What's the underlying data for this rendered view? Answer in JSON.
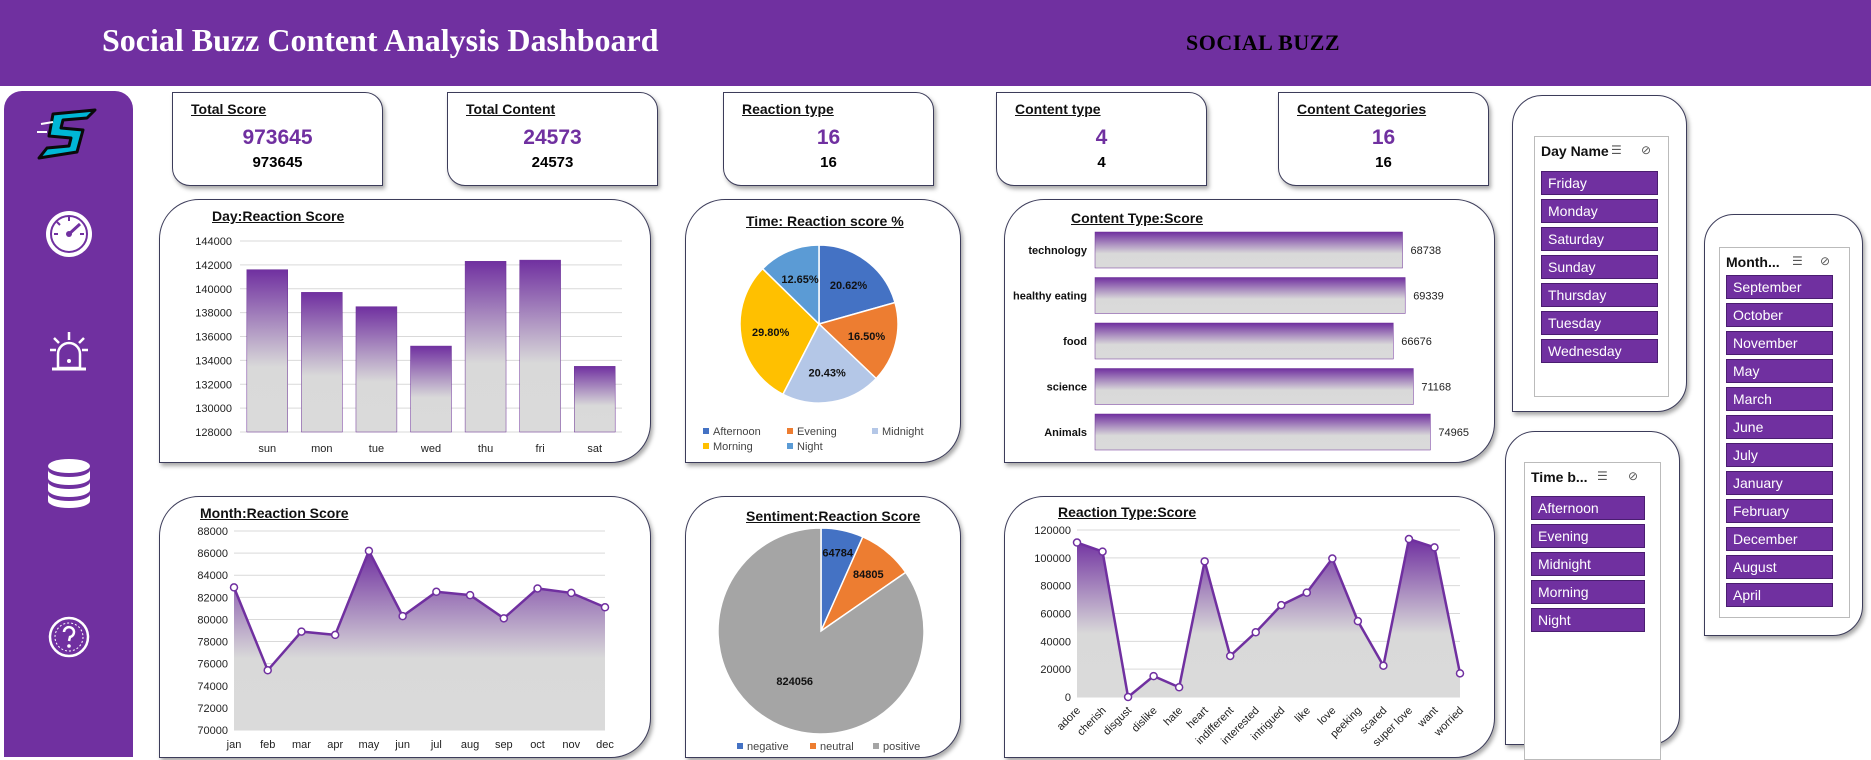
{
  "header": {
    "title": "Social Buzz Content Analysis Dashboard",
    "brand": "SOCIAL BUZZ"
  },
  "sidebar": {
    "icons": [
      "logo-icon",
      "speedometer-icon",
      "alarm-icon",
      "database-icon",
      "help-icon"
    ]
  },
  "kpis": [
    {
      "label": "Total Score",
      "big": "973645",
      "small": "973645"
    },
    {
      "label": "Total Content",
      "big": "24573",
      "small": "24573"
    },
    {
      "label": "Reaction type",
      "big": "16",
      "small": "16"
    },
    {
      "label": "Content type",
      "big": "4",
      "small": "4"
    },
    {
      "label": "Content Categories",
      "big": "16",
      "small": "16"
    }
  ],
  "charts": {
    "day": {
      "title": "Day:Reaction Score"
    },
    "time": {
      "title": "Time: Reaction score %"
    },
    "content": {
      "title": "Content Type:Score"
    },
    "month": {
      "title": "Month:Reaction Score"
    },
    "sentiment": {
      "title": "Sentiment:Reaction Score"
    },
    "reaction": {
      "title": "Reaction Type:Score"
    }
  },
  "chart_data": [
    {
      "id": "day",
      "type": "bar",
      "title": "Day:Reaction Score",
      "categories": [
        "sun",
        "mon",
        "tue",
        "wed",
        "thu",
        "fri",
        "sat"
      ],
      "values": [
        141600,
        139700,
        138500,
        135200,
        142300,
        142400,
        133500
      ],
      "ylim": [
        128000,
        144000
      ],
      "yticks": [
        "144000",
        "142000",
        "140000",
        "138000",
        "136000",
        "134000",
        "132000",
        "130000",
        "128000"
      ]
    },
    {
      "id": "time",
      "type": "pie",
      "title": "Time: Reaction score %",
      "labels": [
        "Afternoon",
        "Evening",
        "Midnight",
        "Morning",
        "Night"
      ],
      "values": [
        20.62,
        16.5,
        20.43,
        29.8,
        12.65
      ],
      "data_labels": [
        "20.62%",
        "16.50%",
        "20.43%",
        "29.80%",
        "12.65%"
      ],
      "colors": [
        "#4472C4",
        "#ED7D31",
        "#B4C7E7",
        "#FFC000",
        "#5B9BD5"
      ]
    },
    {
      "id": "content",
      "type": "bar",
      "orientation": "horizontal",
      "title": "Content Type:Score",
      "categories": [
        "technology",
        "healthy eating",
        "food",
        "science",
        "Animals"
      ],
      "values": [
        68738,
        69339,
        66676,
        71168,
        74965
      ],
      "data_labels": [
        "68738",
        "69339",
        "66676",
        "71168",
        "74965"
      ]
    },
    {
      "id": "month",
      "type": "area",
      "title": "Month:Reaction Score",
      "categories": [
        "jan",
        "feb",
        "mar",
        "apr",
        "may",
        "jun",
        "jul",
        "aug",
        "sep",
        "oct",
        "nov",
        "dec"
      ],
      "values": [
        82900,
        75400,
        78900,
        78600,
        86200,
        80300,
        82500,
        82200,
        80100,
        82800,
        82400,
        81100
      ],
      "ylim": [
        70000,
        88000
      ],
      "yticks": [
        "88000",
        "86000",
        "84000",
        "82000",
        "80000",
        "78000",
        "76000",
        "74000",
        "72000",
        "70000"
      ]
    },
    {
      "id": "sentiment",
      "type": "pie",
      "title": "Sentiment:Reaction Score",
      "labels": [
        "negative",
        "neutral",
        "positive"
      ],
      "values": [
        64784,
        84805,
        824056
      ],
      "data_labels": [
        "64784",
        "84805",
        "824056"
      ],
      "colors": [
        "#4472C4",
        "#ED7D31",
        "#A5A5A5"
      ]
    },
    {
      "id": "reaction",
      "type": "area",
      "title": "Reaction Type:Score",
      "categories": [
        "adore",
        "cherish",
        "disgust",
        "dislike",
        "hate",
        "heart",
        "indifferent",
        "interested",
        "intrigued",
        "like",
        "love",
        "peeking",
        "scared",
        "super love",
        "want",
        "worried"
      ],
      "values": [
        111000,
        104500,
        0,
        15000,
        7000,
        97500,
        29500,
        46500,
        66000,
        75000,
        99500,
        54500,
        22500,
        113500,
        107500,
        17000
      ],
      "ylim": [
        0,
        120000
      ],
      "yticks": [
        "120000",
        "100000",
        "80000",
        "60000",
        "40000",
        "20000",
        "0"
      ]
    }
  ],
  "slicers": {
    "day": {
      "title": "Day Name",
      "items": [
        "Friday",
        "Monday",
        "Saturday",
        "Sunday",
        "Thursday",
        "Tuesday",
        "Wednesday"
      ]
    },
    "month": {
      "title": "Month...",
      "items": [
        "September",
        "October",
        "November",
        "May",
        "March",
        "June",
        "July",
        "January",
        "February",
        "December",
        "August",
        "April"
      ]
    },
    "time": {
      "title": "Time b...",
      "items": [
        "Afternoon",
        "Evening",
        "Midnight",
        "Morning",
        "Night"
      ]
    }
  }
}
